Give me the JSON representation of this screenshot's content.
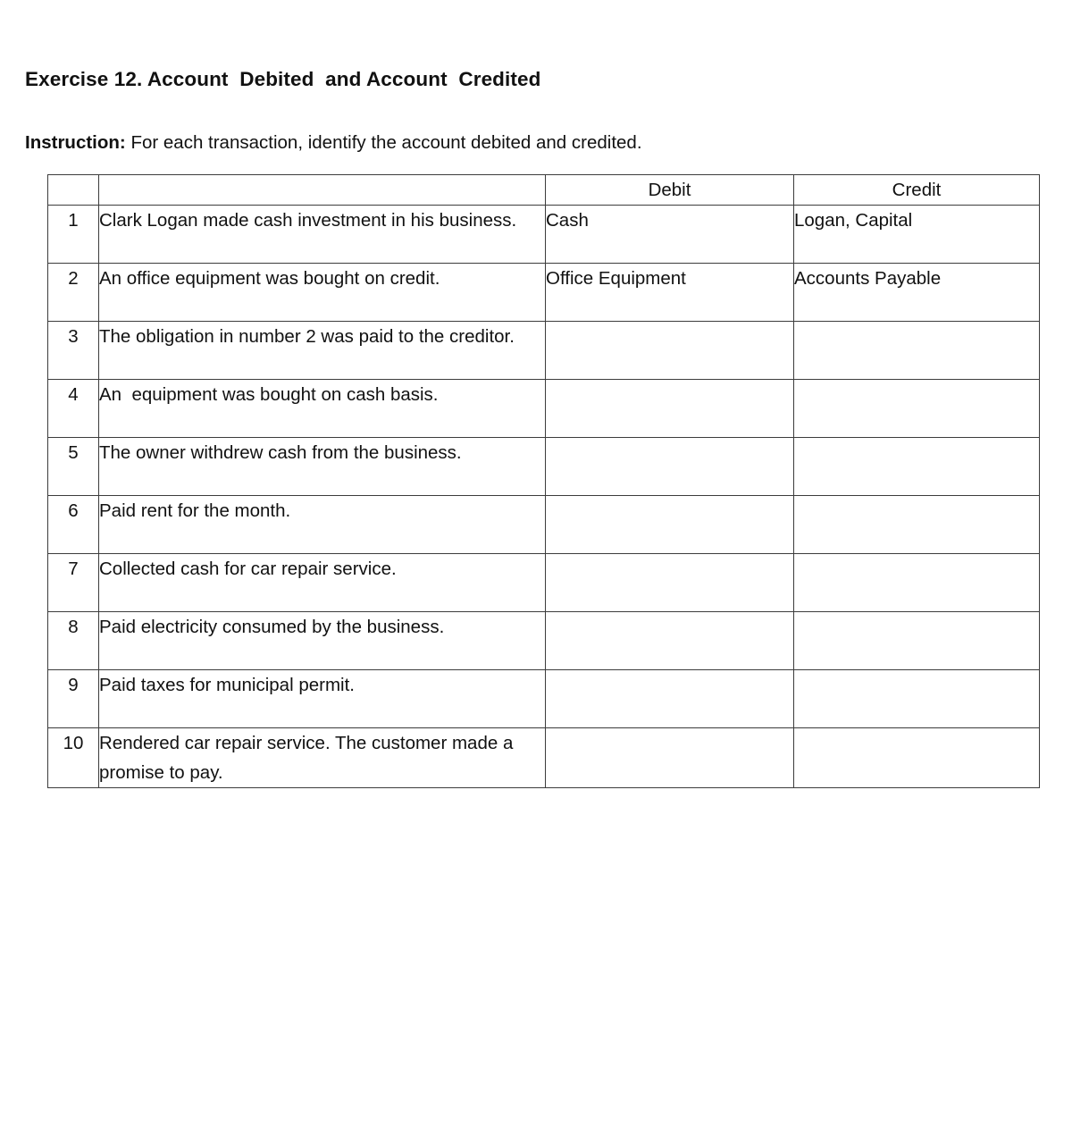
{
  "document": {
    "title": "Exercise 12. Account  Debited  and Account  Credited",
    "instruction_lead": "Instruction:",
    "instruction_text": " For each transaction, identify the account debited and credited."
  },
  "table": {
    "headers": {
      "number": "",
      "transaction": "",
      "debit": "Debit",
      "credit": "Credit"
    },
    "rows": [
      {
        "number": "1",
        "transaction": "Clark Logan made cash investment in his business.",
        "debit": "Cash",
        "credit": "Logan, Capital"
      },
      {
        "number": "2",
        "transaction": "An office equipment was bought on credit.",
        "debit": "Office Equipment",
        "credit": "Accounts Payable"
      },
      {
        "number": "3",
        "transaction": "The obligation in number 2 was paid to the creditor.",
        "debit": "",
        "credit": ""
      },
      {
        "number": "4",
        "transaction": "An  equipment was bought on cash basis.",
        "debit": "",
        "credit": ""
      },
      {
        "number": "5",
        "transaction": "The owner withdrew cash from the business.",
        "debit": "",
        "credit": ""
      },
      {
        "number": "6",
        "transaction": "Paid rent for the month.",
        "debit": "",
        "credit": ""
      },
      {
        "number": "7",
        "transaction": "Collected cash for car repair service.",
        "debit": "",
        "credit": ""
      },
      {
        "number": "8",
        "transaction": "Paid electricity consumed by the business.",
        "debit": "",
        "credit": ""
      },
      {
        "number": "9",
        "transaction": "Paid taxes for municipal permit.",
        "debit": "",
        "credit": ""
      },
      {
        "number": "10",
        "transaction": "Rendered car repair service. The customer made a promise to pay.",
        "debit": "",
        "credit": ""
      }
    ]
  },
  "colors": {
    "page_background": "#ffffff",
    "text": "#111111",
    "table_border": "#3c3c3c"
  }
}
